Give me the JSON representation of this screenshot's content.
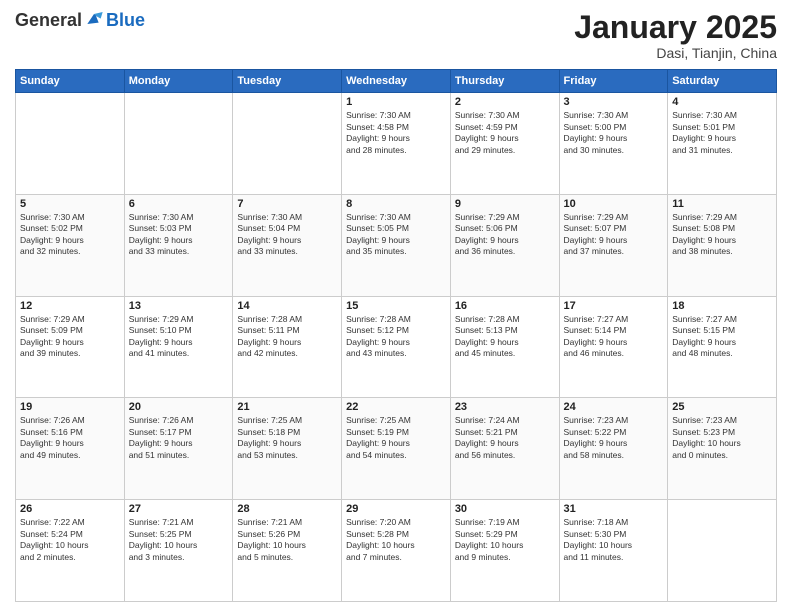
{
  "header": {
    "logo": {
      "general": "General",
      "blue": "Blue"
    },
    "title": "January 2025",
    "location": "Dasi, Tianjin, China"
  },
  "days_of_week": [
    "Sunday",
    "Monday",
    "Tuesday",
    "Wednesday",
    "Thursday",
    "Friday",
    "Saturday"
  ],
  "weeks": [
    [
      {
        "day": "",
        "info": ""
      },
      {
        "day": "",
        "info": ""
      },
      {
        "day": "",
        "info": ""
      },
      {
        "day": "1",
        "info": "Sunrise: 7:30 AM\nSunset: 4:58 PM\nDaylight: 9 hours\nand 28 minutes."
      },
      {
        "day": "2",
        "info": "Sunrise: 7:30 AM\nSunset: 4:59 PM\nDaylight: 9 hours\nand 29 minutes."
      },
      {
        "day": "3",
        "info": "Sunrise: 7:30 AM\nSunset: 5:00 PM\nDaylight: 9 hours\nand 30 minutes."
      },
      {
        "day": "4",
        "info": "Sunrise: 7:30 AM\nSunset: 5:01 PM\nDaylight: 9 hours\nand 31 minutes."
      }
    ],
    [
      {
        "day": "5",
        "info": "Sunrise: 7:30 AM\nSunset: 5:02 PM\nDaylight: 9 hours\nand 32 minutes."
      },
      {
        "day": "6",
        "info": "Sunrise: 7:30 AM\nSunset: 5:03 PM\nDaylight: 9 hours\nand 33 minutes."
      },
      {
        "day": "7",
        "info": "Sunrise: 7:30 AM\nSunset: 5:04 PM\nDaylight: 9 hours\nand 33 minutes."
      },
      {
        "day": "8",
        "info": "Sunrise: 7:30 AM\nSunset: 5:05 PM\nDaylight: 9 hours\nand 35 minutes."
      },
      {
        "day": "9",
        "info": "Sunrise: 7:29 AM\nSunset: 5:06 PM\nDaylight: 9 hours\nand 36 minutes."
      },
      {
        "day": "10",
        "info": "Sunrise: 7:29 AM\nSunset: 5:07 PM\nDaylight: 9 hours\nand 37 minutes."
      },
      {
        "day": "11",
        "info": "Sunrise: 7:29 AM\nSunset: 5:08 PM\nDaylight: 9 hours\nand 38 minutes."
      }
    ],
    [
      {
        "day": "12",
        "info": "Sunrise: 7:29 AM\nSunset: 5:09 PM\nDaylight: 9 hours\nand 39 minutes."
      },
      {
        "day": "13",
        "info": "Sunrise: 7:29 AM\nSunset: 5:10 PM\nDaylight: 9 hours\nand 41 minutes."
      },
      {
        "day": "14",
        "info": "Sunrise: 7:28 AM\nSunset: 5:11 PM\nDaylight: 9 hours\nand 42 minutes."
      },
      {
        "day": "15",
        "info": "Sunrise: 7:28 AM\nSunset: 5:12 PM\nDaylight: 9 hours\nand 43 minutes."
      },
      {
        "day": "16",
        "info": "Sunrise: 7:28 AM\nSunset: 5:13 PM\nDaylight: 9 hours\nand 45 minutes."
      },
      {
        "day": "17",
        "info": "Sunrise: 7:27 AM\nSunset: 5:14 PM\nDaylight: 9 hours\nand 46 minutes."
      },
      {
        "day": "18",
        "info": "Sunrise: 7:27 AM\nSunset: 5:15 PM\nDaylight: 9 hours\nand 48 minutes."
      }
    ],
    [
      {
        "day": "19",
        "info": "Sunrise: 7:26 AM\nSunset: 5:16 PM\nDaylight: 9 hours\nand 49 minutes."
      },
      {
        "day": "20",
        "info": "Sunrise: 7:26 AM\nSunset: 5:17 PM\nDaylight: 9 hours\nand 51 minutes."
      },
      {
        "day": "21",
        "info": "Sunrise: 7:25 AM\nSunset: 5:18 PM\nDaylight: 9 hours\nand 53 minutes."
      },
      {
        "day": "22",
        "info": "Sunrise: 7:25 AM\nSunset: 5:19 PM\nDaylight: 9 hours\nand 54 minutes."
      },
      {
        "day": "23",
        "info": "Sunrise: 7:24 AM\nSunset: 5:21 PM\nDaylight: 9 hours\nand 56 minutes."
      },
      {
        "day": "24",
        "info": "Sunrise: 7:23 AM\nSunset: 5:22 PM\nDaylight: 9 hours\nand 58 minutes."
      },
      {
        "day": "25",
        "info": "Sunrise: 7:23 AM\nSunset: 5:23 PM\nDaylight: 10 hours\nand 0 minutes."
      }
    ],
    [
      {
        "day": "26",
        "info": "Sunrise: 7:22 AM\nSunset: 5:24 PM\nDaylight: 10 hours\nand 2 minutes."
      },
      {
        "day": "27",
        "info": "Sunrise: 7:21 AM\nSunset: 5:25 PM\nDaylight: 10 hours\nand 3 minutes."
      },
      {
        "day": "28",
        "info": "Sunrise: 7:21 AM\nSunset: 5:26 PM\nDaylight: 10 hours\nand 5 minutes."
      },
      {
        "day": "29",
        "info": "Sunrise: 7:20 AM\nSunset: 5:28 PM\nDaylight: 10 hours\nand 7 minutes."
      },
      {
        "day": "30",
        "info": "Sunrise: 7:19 AM\nSunset: 5:29 PM\nDaylight: 10 hours\nand 9 minutes."
      },
      {
        "day": "31",
        "info": "Sunrise: 7:18 AM\nSunset: 5:30 PM\nDaylight: 10 hours\nand 11 minutes."
      },
      {
        "day": "",
        "info": ""
      }
    ]
  ]
}
